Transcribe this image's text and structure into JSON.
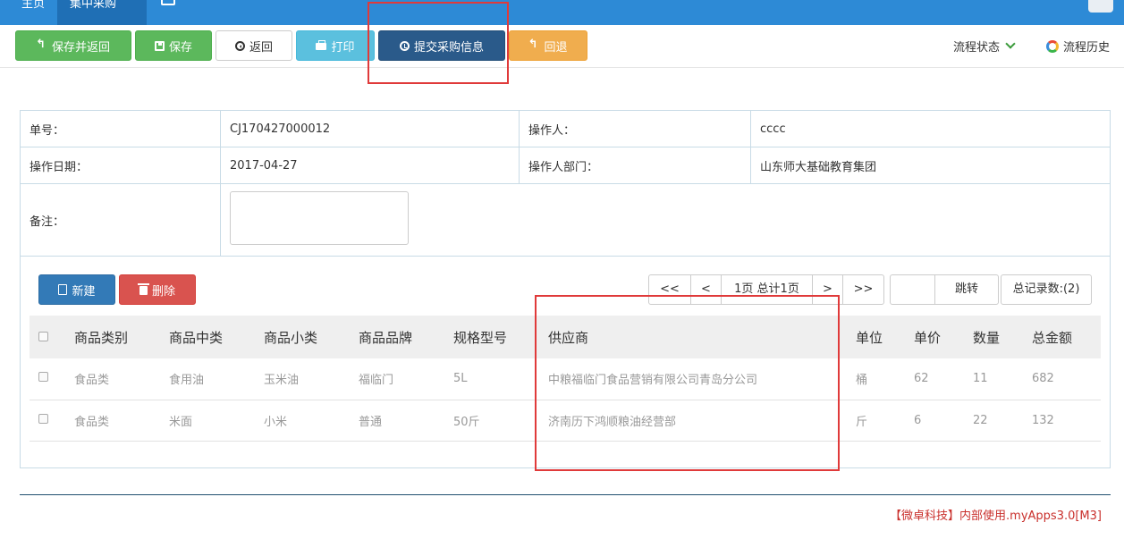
{
  "topbar": {
    "home_tab": "主页",
    "active_tab": "集中采购"
  },
  "toolbar": {
    "save_return": "保存并返回",
    "save": "保存",
    "back": "返回",
    "print": "打印",
    "submit": "提交采购信息",
    "rollback": "回退",
    "flow_status": "流程状态",
    "flow_history": "流程历史"
  },
  "form": {
    "order_no_label": "单号：",
    "order_no": "CJ170427000012",
    "operator_label": "操作人：",
    "operator": "cccc",
    "date_label": "操作日期：",
    "date": "2017-04-27",
    "dept_label": "操作人部门：",
    "dept": "山东师大基础教育集团",
    "remark_label": "备注：",
    "remark": ""
  },
  "detail": {
    "new_button": "新建",
    "delete_button": "删除",
    "pager": {
      "first": "<<",
      "prev": "<",
      "info": "1页 总计1页",
      "next": ">",
      "last": ">>"
    },
    "jump_input": "",
    "jump_button": "跳转",
    "total": "总记录数:(2)",
    "columns": [
      "商品类别",
      "商品中类",
      "商品小类",
      "商品品牌",
      "规格型号",
      "供应商",
      "单位",
      "单价",
      "数量",
      "总金额"
    ],
    "rows": [
      [
        "食品类",
        "食用油",
        "玉米油",
        "福临门",
        "5L",
        "中粮福临门食品营销有限公司青岛分公司",
        "桶",
        "62",
        "11",
        "682"
      ],
      [
        "食品类",
        "米面",
        "小米",
        "普通",
        "50斤",
        "济南历下鸿顺粮油经营部",
        "斤",
        "6",
        "22",
        "132"
      ]
    ]
  },
  "footer": "【微卓科技】内部使用.myApps3.0[M3]",
  "colors": {
    "topbar": "#2d8ad6",
    "highlight": "#e03a3a",
    "submit_button": "#2a5a8a"
  }
}
